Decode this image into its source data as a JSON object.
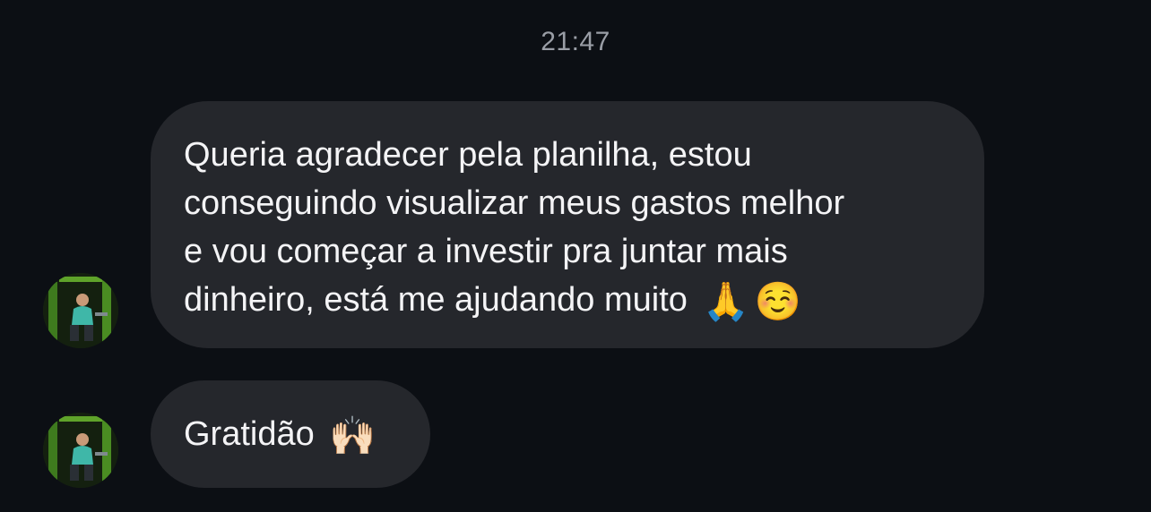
{
  "conversation": {
    "timestamp": "21:47",
    "messages": [
      {
        "lines": [
          "Queria agradecer pela planilha, estou",
          "conseguindo visualizar meus gastos melhor",
          "e vou começar a investir pra juntar mais",
          "dinheiro, está me ajudando muito"
        ],
        "emoji_1": "🙏",
        "emoji_2": "☺️",
        "avatar_icon": "profile-photo-icon"
      },
      {
        "text": "Gratidão",
        "emoji_1": "🙌🏻",
        "avatar_icon": "profile-photo-icon"
      }
    ]
  },
  "colors": {
    "background": "#0c0f14",
    "bubble": "#25272c",
    "text": "#f4f4f6",
    "timestamp": "#9a9ea6"
  }
}
